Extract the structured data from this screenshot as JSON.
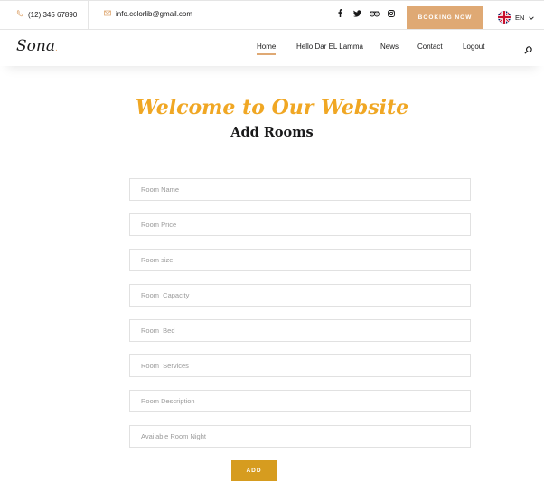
{
  "topbar": {
    "phone": "(12) 345 67890",
    "email": "info.colorlib@gmail.com",
    "social": [
      "f",
      "t",
      "tripadvisor",
      "instagram"
    ],
    "booking_label": "BOOKING NOW",
    "language": "EN"
  },
  "header": {
    "logo": "Sona",
    "nav": [
      {
        "label": "Home",
        "active": true
      },
      {
        "label": "Hello Dar EL Lamma",
        "active": false
      },
      {
        "label": "News",
        "active": false
      },
      {
        "label": "Contact",
        "active": false
      },
      {
        "label": "Logout",
        "active": false
      }
    ]
  },
  "main": {
    "welcome": "Welcome to Our Website",
    "subtitle": "Add Rooms",
    "fields": [
      {
        "placeholder": "Room Name",
        "value": ""
      },
      {
        "placeholder": "Room Price",
        "value": ""
      },
      {
        "placeholder": "Room size",
        "value": ""
      },
      {
        "placeholder": "Room  Capacity",
        "value": ""
      },
      {
        "placeholder": "Room  Bed",
        "value": ""
      },
      {
        "placeholder": "Room  Services",
        "value": ""
      },
      {
        "placeholder": "Room Description",
        "value": ""
      },
      {
        "placeholder": "Available Room Night",
        "value": ""
      }
    ],
    "submit_label": "ADD"
  },
  "colors": {
    "accent": "#dfa974",
    "welcome": "#f0a724",
    "add_button": "#d69c1f"
  },
  "icons": [
    "phone-icon",
    "mail-icon",
    "facebook-icon",
    "twitter-icon",
    "tripadvisor-icon",
    "instagram-icon",
    "uk-flag-icon",
    "chevron-down-icon",
    "search-icon"
  ]
}
